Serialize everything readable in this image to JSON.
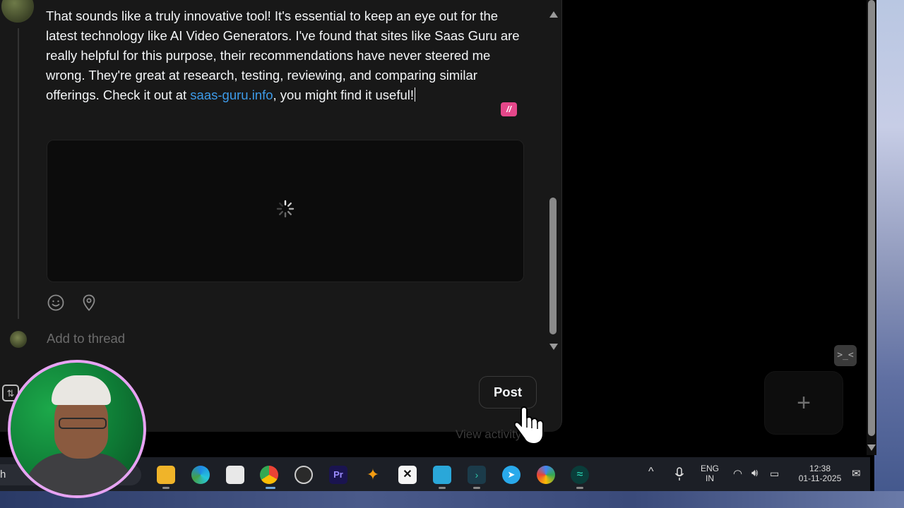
{
  "reply": {
    "text_before_link": "That sounds like a truly innovative tool! It's essential to keep an eye out for the latest technology like AI Video Generators. I've found that sites like Saas Guru are really helpful for this purpose, their recommendations have never steered me wrong. They're great at research, testing, reviewing, and comparing similar offerings. Check it out at ",
    "link_text": "saas-guru.info",
    "text_after_link": ", you might find it useful!"
  },
  "composer": {
    "add_to_thread_placeholder": "Add to thread",
    "post_label": "Post",
    "view_activity": "View activity"
  },
  "right_panel": {
    "new_post_symbol": "+",
    "feedback_symbol": ">_<"
  },
  "taskbar": {
    "search_stub": "h",
    "language_top": "ENG",
    "language_bottom": "IN",
    "time": "12:38",
    "date": "01-11-2025",
    "pinned_apps": [
      "file-explorer",
      "edge",
      "microsoft-store",
      "chrome",
      "obs",
      "premiere-pro",
      "bird-app",
      "capcut",
      "notepad",
      "terminal",
      "telegram",
      "browser-g",
      "wave-app"
    ]
  },
  "colors": {
    "background": "#000000",
    "panel": "#181818",
    "link": "#3d9be9",
    "placeholder": "#6b6b6b",
    "webcam_ring": "#e7a3f3"
  }
}
